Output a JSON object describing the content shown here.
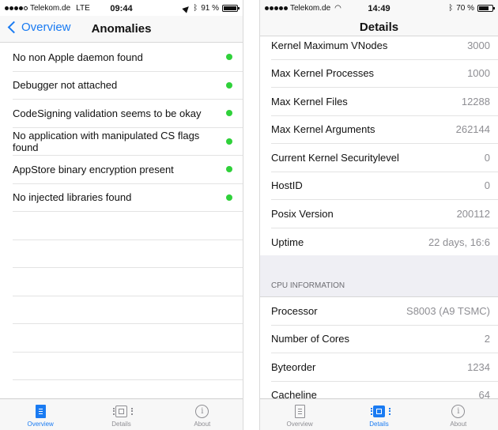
{
  "left": {
    "status": {
      "carrier": "Telekom.de",
      "network": "LTE",
      "time": "09:44",
      "battery": "91 %",
      "battery_level": 0.91
    },
    "nav": {
      "back_label": "Overview",
      "title": "Anomalies"
    },
    "items": [
      {
        "label": "No non Apple daemon found",
        "status_color": "#2fd13a"
      },
      {
        "label": "Debugger not attached",
        "status_color": "#2fd13a"
      },
      {
        "label": "CodeSigning validation seems to be okay",
        "status_color": "#2fd13a"
      },
      {
        "label": "No application with manipulated CS flags found",
        "status_color": "#2fd13a"
      },
      {
        "label": "AppStore binary encryption present",
        "status_color": "#2fd13a"
      },
      {
        "label": "No injected libraries found",
        "status_color": "#2fd13a"
      }
    ],
    "tabs": [
      {
        "label": "Overview",
        "icon": "document-icon",
        "active": true
      },
      {
        "label": "Details",
        "icon": "chip-icon",
        "active": false
      },
      {
        "label": "About",
        "icon": "info-icon",
        "active": false
      }
    ]
  },
  "right": {
    "status": {
      "carrier": "Telekom.de",
      "network": "wifi",
      "time": "14:49",
      "battery": "70 %",
      "battery_level": 0.7
    },
    "nav": {
      "title": "Details"
    },
    "rows": [
      {
        "label": "Kernel Maximum VNodes",
        "value": "3000"
      },
      {
        "label": "Max Kernel Processes",
        "value": "1000"
      },
      {
        "label": "Max Kernel Files",
        "value": "12288"
      },
      {
        "label": "Max Kernel Arguments",
        "value": "262144"
      },
      {
        "label": "Current Kernel Securitylevel",
        "value": "0"
      },
      {
        "label": "HostID",
        "value": "0"
      },
      {
        "label": "Posix Version",
        "value": "200112"
      },
      {
        "label": "Uptime",
        "value": "22 days, 16:6"
      }
    ],
    "section_title": "CPU INFORMATION",
    "cpu_rows": [
      {
        "label": "Processor",
        "value": "S8003 (A9 TSMC)"
      },
      {
        "label": "Number of Cores",
        "value": "2"
      },
      {
        "label": "Byteorder",
        "value": "1234"
      },
      {
        "label": "Cacheline",
        "value": "64"
      }
    ],
    "tabs": [
      {
        "label": "Overview",
        "icon": "document-icon",
        "active": false
      },
      {
        "label": "Details",
        "icon": "chip-icon",
        "active": true
      },
      {
        "label": "About",
        "icon": "info-icon",
        "active": false
      }
    ]
  }
}
